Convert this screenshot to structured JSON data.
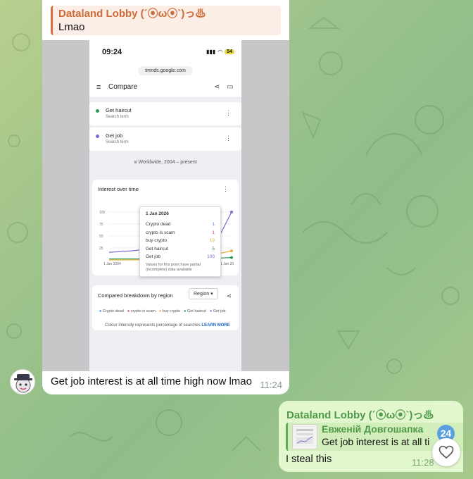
{
  "colors": {
    "incoming_bubble": "#ffffff",
    "outgoing_bubble": "#e2f7cd",
    "reply_accent": "#d8703b",
    "quote_accent": "#62a95a",
    "badge": "#5aa0e0"
  },
  "incoming": {
    "reply_name": "Dataland Lobby (´⦿ω⦿`)っ♨",
    "reply_text": "Lmao",
    "caption": "Get job interest is at all time high now lmao",
    "time": "11:24",
    "avatar_icon": "avatar-icon"
  },
  "screenshot": {
    "status_time": "09:24",
    "battery": "54",
    "url": "trends.google.com",
    "app_title": "Compare",
    "terms": [
      {
        "name": "Get haircut",
        "sub": "Search term",
        "color": "#2e9a4e"
      },
      {
        "name": "Get job",
        "sub": "Search term",
        "color": "#7b6ad6"
      }
    ],
    "region_text": "Worldwide, 2004 – present",
    "chart_title": "Interest over time",
    "tooltip": {
      "date": "1 Jan 2026",
      "rows": [
        {
          "label": "Crypto dead",
          "value": "1",
          "color": "#4a79d6"
        },
        {
          "label": "crypto is scam",
          "value": "1",
          "color": "#d24b4b"
        },
        {
          "label": "buy crypto",
          "value": "19",
          "color": "#e3b331"
        },
        {
          "label": "Get haircut",
          "value": "5",
          "color": "#2e9a4e"
        },
        {
          "label": "Get job",
          "value": "100",
          "color": "#7b6ad6"
        }
      ],
      "note": "Values for this point have partial (incomplete) data available"
    },
    "y_ticks": [
      "100",
      "75",
      "50",
      "25"
    ],
    "x_start": "1 Jan 2004",
    "x_end": "1 Jan 20",
    "breakdown_title": "Compared breakdown by region",
    "region_button": "Region",
    "legend": [
      "Crypto dead",
      "crypto is scam",
      "buy crypto",
      "Get haircut",
      "Get job"
    ],
    "breakdown_note": "Colour intensity represents percentage of searches",
    "learn_more": "LEARN MORE",
    "chart_data": {
      "type": "line",
      "title": "Interest over time",
      "ylim": [
        0,
        100
      ],
      "series": [
        {
          "name": "Get job",
          "x": [
            2004,
            2008,
            2012,
            2016,
            2020,
            2024,
            2026
          ],
          "values": [
            16,
            19,
            24,
            26,
            36,
            54,
            100
          ]
        },
        {
          "name": "Get haircut",
          "x": [
            2004,
            2008,
            2012,
            2016,
            2020,
            2024,
            2026
          ],
          "values": [
            2,
            2,
            2,
            3,
            3,
            4,
            5
          ]
        },
        {
          "name": "buy crypto",
          "x": [
            2004,
            2008,
            2012,
            2016,
            2020,
            2024,
            2026
          ],
          "values": [
            0,
            0,
            1,
            2,
            10,
            14,
            19
          ]
        }
      ]
    }
  },
  "outgoing": {
    "sender_name": "Dataland Lobby (´⦿ω⦿`)っ♨",
    "quote_name": "Евженій Довгошапка",
    "quote_text": "Get job interest is at all ti",
    "text": "I steal this",
    "time": "11:28",
    "reaction_count": "24",
    "reaction_icon": "heart-icon"
  }
}
